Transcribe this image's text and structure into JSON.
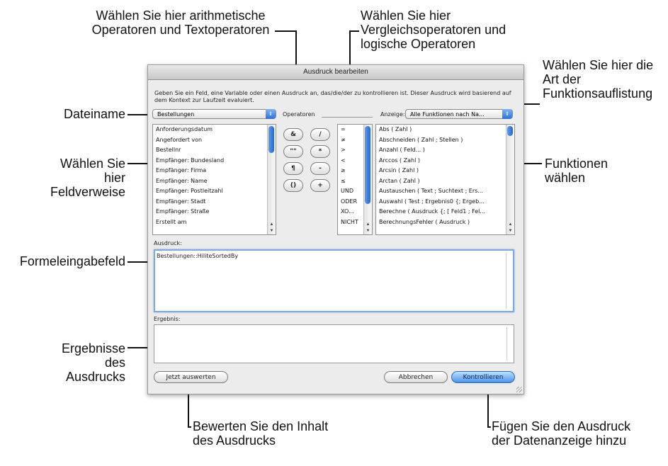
{
  "callouts": {
    "arith": "Wählen Sie hier arithmetische Operatoren und Textoperatoren",
    "compare": "Wählen Sie hier Vergleichsoperatoren und logische Operatoren",
    "view_type": "Wählen Sie hier die Art der Funktionsauflistung",
    "filename": "Dateiname",
    "field_refs": "Wählen Sie hier Feldverweise",
    "functions": "Funktionen wählen",
    "formula_field": "Formeleingabefeld",
    "results": "Ergebnisse des Ausdrucks",
    "evaluate": "Bewerten Sie den Inhalt des Ausdrucks",
    "add": "Fügen Sie den Ausdruck der Datenanzeige hinzu"
  },
  "dialog": {
    "title": "Ausdruck bearbeiten",
    "description": "Geben Sie ein Feld, eine Variable oder einen Ausdruck an, das/die/der zu kontrollieren ist. Dieser Ausdruck wird basierend auf dem Kontext zur Laufzeit evaluiert.",
    "table_select": "Bestellungen",
    "operators_label": "Operatoren",
    "view_label": "Anzeige:",
    "view_select": "Alle Funktionen nach Na...",
    "fields": [
      "Anforderungsdatum",
      "Angefordert von",
      "Bestellnr",
      "Empfänger: Bundesland",
      "Empfänger: Firma",
      "Empfänger: Name",
      "Empfänger: Postleitzahl",
      "Empfänger: Stadt",
      "Empfänger: Straße",
      "Erstellt am"
    ],
    "op_buttons": [
      "&",
      "/",
      "\"\"",
      "*",
      "¶",
      "-",
      "()",
      "+"
    ],
    "compare_ops": [
      "=",
      "≠",
      ">",
      "<",
      "≥",
      "≤",
      "UND",
      "ODER",
      "XO...",
      "NICHT"
    ],
    "functions": [
      "Abs ( Zahl )",
      "Abschneiden ( Zahl ; Stellen )",
      "Anzahl ( Feld... )",
      "Arccos ( Zahl )",
      "Arcsin ( Zahl )",
      "Arctan ( Zahl )",
      "Austauschen ( Text ; Suchtext ; Ers...",
      "Auswahl ( Test ; Ergebnis0 {; Ergeb...",
      "Berechne ( Ausdruck {; [ Feld1 ; Fel...",
      "BerechnungsFehler ( Ausdruck )"
    ],
    "expression_label": "Ausdruck:",
    "expression_value": "Bestellungen::HiliteSortedBy",
    "result_label": "Ergebnis:",
    "evaluate_button": "Jetzt auswerten",
    "cancel_button": "Abbrechen",
    "ok_button": "Kontrollieren"
  }
}
